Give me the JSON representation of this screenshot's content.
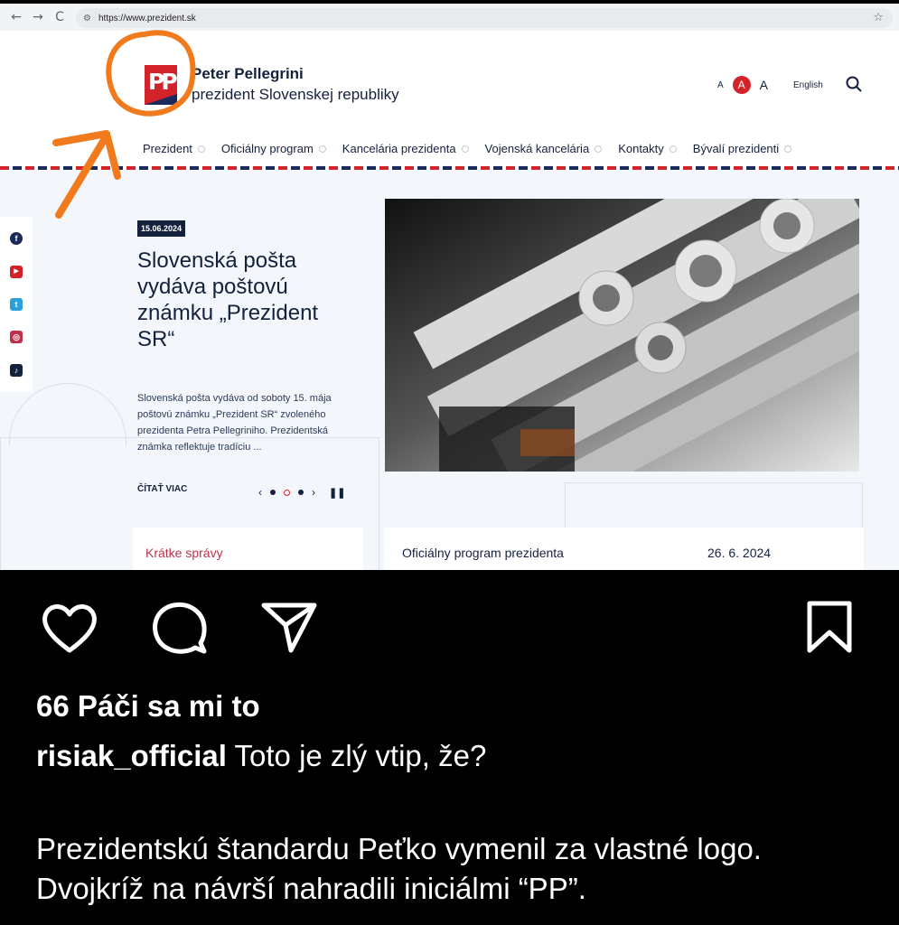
{
  "browser": {
    "url": "https://www.prezident.sk",
    "back_icon": "←",
    "forward_icon": "→",
    "reload_icon": "C",
    "site_info_icon": "⚙",
    "bookmark_icon": "☆"
  },
  "site": {
    "logo_text": "PP",
    "name": "Peter Pellegrini",
    "subtitle": "prezident Slovenskej republiky",
    "font_size": {
      "small": "A",
      "medium": "A",
      "large": "A"
    },
    "language_label": "English",
    "nav": [
      {
        "label": "Prezident"
      },
      {
        "label": "Oficiálny program"
      },
      {
        "label": "Kancelária prezidenta"
      },
      {
        "label": "Vojenská kancelária"
      },
      {
        "label": "Kontakty"
      },
      {
        "label": "Bývalí prezidenti"
      }
    ],
    "social": [
      {
        "icon": "facebook-icon",
        "glyph": "f",
        "color": "#1b2a5c"
      },
      {
        "icon": "youtube-icon",
        "glyph": "▶",
        "color": "#d2232a"
      },
      {
        "icon": "twitter-icon",
        "glyph": "t",
        "color": "#2a9fd8"
      },
      {
        "icon": "instagram-icon",
        "glyph": "◎",
        "color": "#c0304a"
      },
      {
        "icon": "tiktok-icon",
        "glyph": "♪",
        "color": "#14213d"
      }
    ],
    "article": {
      "date": "15.06.2024",
      "title": "Slovenská pošta vydáva poštovú známku „Prezident SR“",
      "excerpt": "Slovenská pošta vydáva od soboty 15. mája poštovú známku „Prezident SR“ zvoleného prezidenta Petra Pellegriniho. Prezidentská známka reflektuje tradíciu ...",
      "read_more": "ČÍTAŤ VIAC",
      "slides": 3,
      "active_slide": 2
    },
    "cards": {
      "news_title": "Krátke správy",
      "program_title": "Oficiálny program prezidenta",
      "program_date": "26. 6. 2024"
    },
    "colors": {
      "brand_red": "#d2232a",
      "brand_navy": "#1b2a5c",
      "annotation_orange": "#f07a1c"
    }
  },
  "instagram": {
    "likes": "66 Páči sa mi to",
    "username": "risiak_official",
    "caption_line1": "Toto je zlý vtip, že?",
    "caption_body": "Prezidentskú štandardu Peťko vymenil za vlastné logo. Dvojkríž na návrší nahradili iniciálmi “PP”."
  }
}
